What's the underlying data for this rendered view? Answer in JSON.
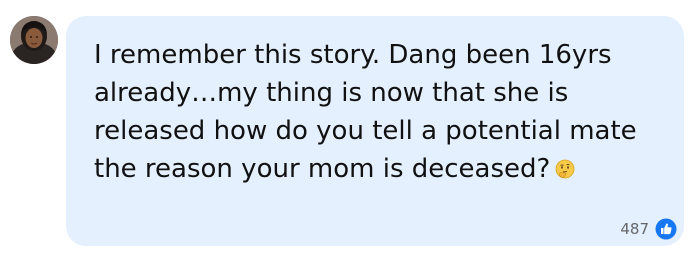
{
  "comment": {
    "text": "I remember this story. Dang been 16yrs already…my thing is now that she is released how do you tell a potential mate the reason your mom is deceased?",
    "emoji_icon": "thinking-face-icon"
  },
  "reactions": {
    "count": "487",
    "icon": "like-thumbs-up-icon",
    "color": "#1877f2"
  },
  "colors": {
    "bubble_background": "#e4f0fe",
    "text": "#111111",
    "count_text": "#65676b"
  }
}
